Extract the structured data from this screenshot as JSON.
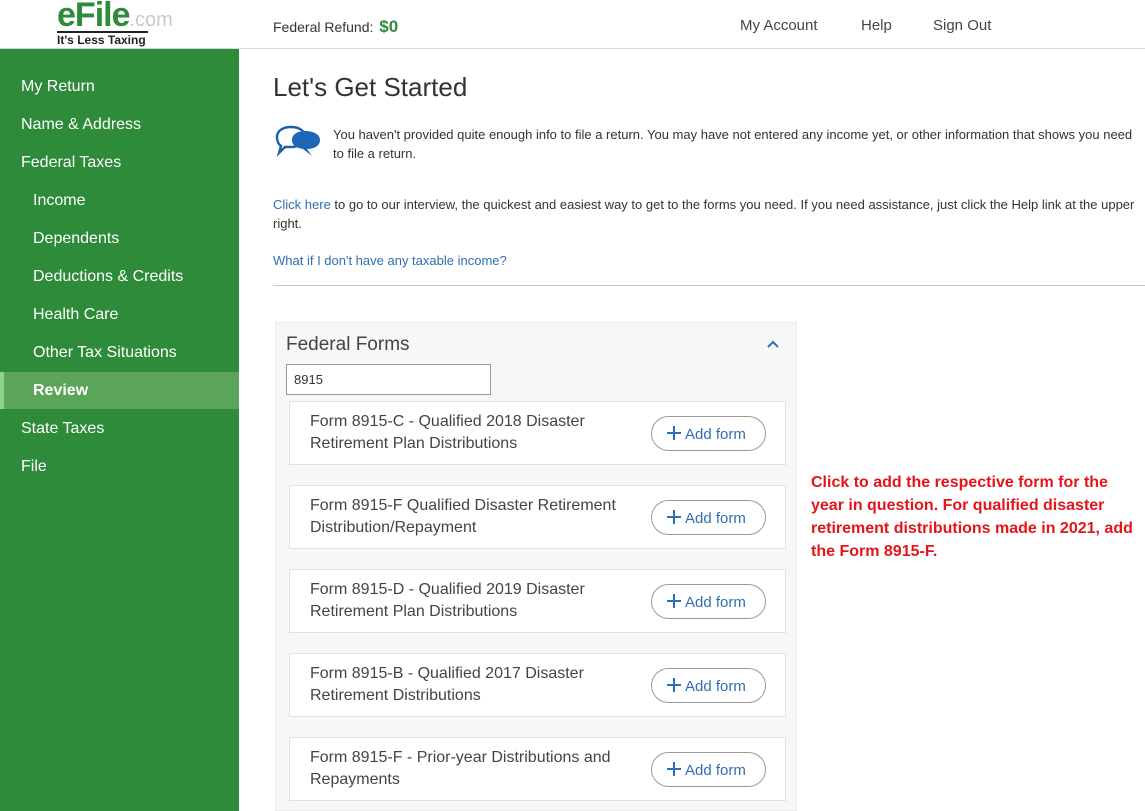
{
  "header": {
    "logo_e": "e",
    "logo_file": "File",
    "logo_dotcom": ".com",
    "logo_tagline": "It's Less Taxing",
    "refund_label": "Federal Refund:",
    "refund_amount": "$0",
    "nav": [
      "My Account",
      "Help",
      "Sign Out"
    ]
  },
  "sidebar": {
    "items": [
      {
        "label": "My Return"
      },
      {
        "label": "Name & Address"
      },
      {
        "label": "Federal Taxes"
      },
      {
        "label": "Income"
      },
      {
        "label": "Dependents"
      },
      {
        "label": "Deductions & Credits"
      },
      {
        "label": "Health Care"
      },
      {
        "label": "Other Tax Situations"
      },
      {
        "label": "Review"
      },
      {
        "label": "State Taxes"
      },
      {
        "label": "File"
      }
    ],
    "active": "Review"
  },
  "main": {
    "title": "Let's Get Started",
    "info_icon": "chat-bubbles-icon",
    "info_text": "You haven't provided quite enough info to file a return. You may have not entered any income yet, or other information that shows you need to file a return.",
    "click_here_link": "Click here",
    "click_here_rest": " to go to our interview, the quickest and easiest way to get to the forms you need. If you need assistance, just click the Help link at the upper right.",
    "taxable_link": "What if I don't have any taxable income?"
  },
  "federal_forms": {
    "title": "Federal Forms",
    "collapse_icon": "chevron-up-icon",
    "search_value": "8915",
    "add_label": "Add form",
    "forms": [
      {
        "name": "Form 8915-C - Qualified 2018 Disaster Retirement Plan Distributions"
      },
      {
        "name": "Form 8915-F Qualified Disaster Retirement Distribution/Repayment"
      },
      {
        "name": "Form 8915-D - Qualified 2019 Disaster Retirement Plan Distributions"
      },
      {
        "name": "Form 8915-B - Qualified 2017 Disaster Retirement Distributions"
      },
      {
        "name": "Form 8915-F - Prior-year Distributions and Repayments"
      }
    ]
  },
  "annotation": {
    "text": "Click to add the respective form for the year in question. For qualified disaster retirement distributions made in 2021, add the Form 8915-F.",
    "color": "#e4141b"
  },
  "colors": {
    "brand_green": "#2e8b3a",
    "active_item": "#5aa55a",
    "link_blue": "#2f6fb3"
  }
}
